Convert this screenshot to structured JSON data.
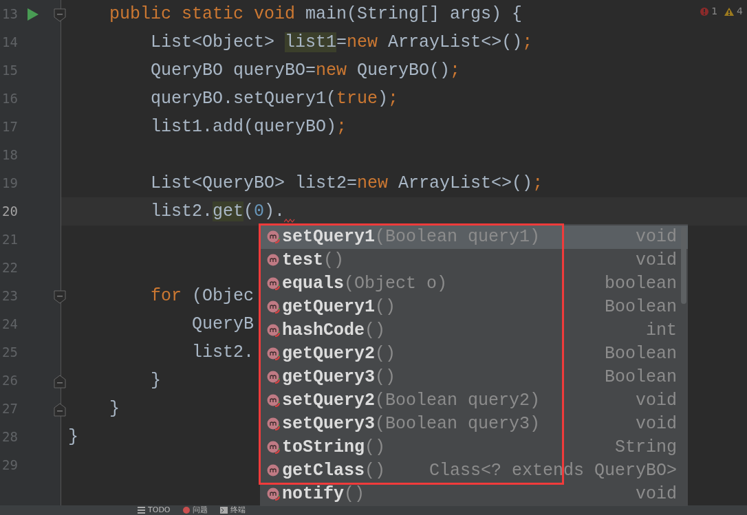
{
  "inspections": {
    "errors": "1",
    "warnings": "4"
  },
  "lines": [
    {
      "number": "13",
      "run": true,
      "fold_open": true,
      "current": false,
      "tokens": [
        {
          "text": "    public static void ",
          "kind": "keyword"
        },
        {
          "text": "main(String[] args) {",
          "kind": "plain"
        }
      ]
    },
    {
      "number": "14",
      "current": false,
      "tokens": [
        {
          "text": "        List<Object> ",
          "kind": "plain"
        },
        {
          "text": "list1",
          "kind": "highlight"
        },
        {
          "text": "=",
          "kind": "plain"
        },
        {
          "text": "new ",
          "kind": "keyword"
        },
        {
          "text": "ArrayList<>()",
          "kind": "plain"
        },
        {
          "text": ";",
          "kind": "keyword"
        }
      ]
    },
    {
      "number": "15",
      "current": false,
      "tokens": [
        {
          "text": "        QueryBO queryBO=",
          "kind": "plain"
        },
        {
          "text": "new ",
          "kind": "keyword"
        },
        {
          "text": "QueryBO()",
          "kind": "plain"
        },
        {
          "text": ";",
          "kind": "keyword"
        }
      ]
    },
    {
      "number": "16",
      "current": false,
      "tokens": [
        {
          "text": "        queryBO.setQuery1(",
          "kind": "plain"
        },
        {
          "text": "true",
          "kind": "keyword"
        },
        {
          "text": ")",
          "kind": "plain"
        },
        {
          "text": ";",
          "kind": "keyword"
        }
      ]
    },
    {
      "number": "17",
      "current": false,
      "tokens": [
        {
          "text": "        list1.add(queryBO)",
          "kind": "plain"
        },
        {
          "text": ";",
          "kind": "keyword"
        }
      ]
    },
    {
      "number": "18",
      "current": false
    },
    {
      "number": "19",
      "current": false,
      "tokens": [
        {
          "text": "        List<QueryBO> list2=",
          "kind": "plain"
        },
        {
          "text": "new ",
          "kind": "keyword"
        },
        {
          "text": "ArrayList<>()",
          "kind": "plain"
        },
        {
          "text": ";",
          "kind": "keyword"
        }
      ]
    },
    {
      "number": "20",
      "current": true,
      "tokens": [
        {
          "text": "        list2.",
          "kind": "plain"
        },
        {
          "text": "get",
          "kind": "highlight"
        },
        {
          "text": "(",
          "kind": "plain"
        },
        {
          "text": "0",
          "kind": "number"
        },
        {
          "text": ").",
          "kind": "plain"
        }
      ]
    },
    {
      "number": "21",
      "current": false
    },
    {
      "number": "22",
      "current": false
    },
    {
      "number": "23",
      "fold_open": true,
      "current": false,
      "tokens": [
        {
          "text": "        for ",
          "kind": "keyword"
        },
        {
          "text": "(Objec",
          "kind": "plain"
        }
      ]
    },
    {
      "number": "24",
      "current": false,
      "tokens": [
        {
          "text": "            QueryB",
          "kind": "plain"
        }
      ]
    },
    {
      "number": "25",
      "current": false,
      "tokens": [
        {
          "text": "            list2.",
          "kind": "plain"
        }
      ]
    },
    {
      "number": "26",
      "fold_close": true,
      "current": false,
      "tokens": [
        {
          "text": "        }",
          "kind": "plain"
        }
      ]
    },
    {
      "number": "27",
      "fold_close": true,
      "current": false,
      "tokens": [
        {
          "text": "    }",
          "kind": "plain"
        }
      ]
    },
    {
      "number": "28",
      "current": false,
      "tokens": [
        {
          "text": "}",
          "kind": "plain"
        }
      ]
    },
    {
      "number": "29",
      "current": false
    }
  ],
  "completion": {
    "items": [
      {
        "name": "setQuery1",
        "params": "(Boolean query1)",
        "type": "void",
        "selected": true,
        "badge": true
      },
      {
        "name": "test",
        "params": "()",
        "type": "void",
        "selected": false,
        "badge": false
      },
      {
        "name": "equals",
        "params": "(Object o)",
        "type": "boolean",
        "selected": false,
        "badge": true
      },
      {
        "name": "getQuery1",
        "params": "()",
        "type": "Boolean",
        "selected": false,
        "badge": true
      },
      {
        "name": "hashCode",
        "params": "()",
        "type": "int",
        "selected": false,
        "badge": true
      },
      {
        "name": "getQuery2",
        "params": "()",
        "type": "Boolean",
        "selected": false,
        "badge": true
      },
      {
        "name": "getQuery3",
        "params": "()",
        "type": "Boolean",
        "selected": false,
        "badge": true
      },
      {
        "name": "setQuery2",
        "params": "(Boolean query2)",
        "type": "void",
        "selected": false,
        "badge": true
      },
      {
        "name": "setQuery3",
        "params": "(Boolean query3)",
        "type": "void",
        "selected": false,
        "badge": true
      },
      {
        "name": "toString",
        "params": "()",
        "type": "String",
        "selected": false,
        "badge": true
      },
      {
        "name": "getClass",
        "params": "()",
        "type": "Class<? extends QueryBO>",
        "selected": false,
        "badge": false
      },
      {
        "name": "notify",
        "params": "()",
        "type": "void",
        "selected": false,
        "badge": true
      }
    ]
  },
  "tool_windows": [
    {
      "kind": "list",
      "label": "TODO"
    },
    {
      "kind": "problems",
      "label": "问题"
    },
    {
      "kind": "terminal",
      "label": "终端"
    }
  ]
}
